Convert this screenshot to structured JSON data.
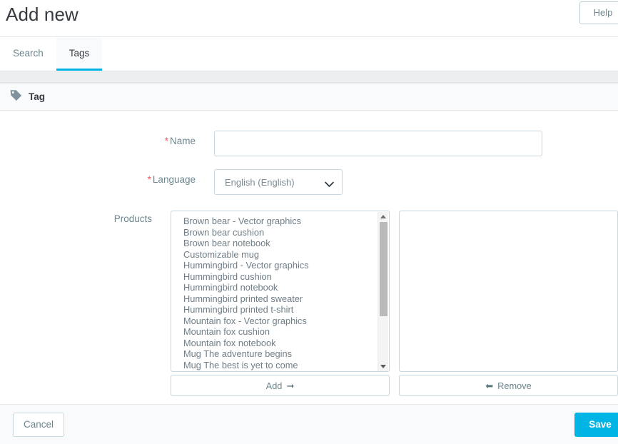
{
  "header": {
    "title": "Add new",
    "help_label": "Help"
  },
  "tabs": [
    {
      "label": "Search",
      "active": false
    },
    {
      "label": "Tags",
      "active": true
    }
  ],
  "panel": {
    "icon": "tag-icon",
    "title": "Tag"
  },
  "form": {
    "name": {
      "label": "Name",
      "required_marker": "*",
      "value": "",
      "placeholder": ""
    },
    "language": {
      "label": "Language",
      "required_marker": "*",
      "selected": "English (English)",
      "options": [
        "English (English)"
      ],
      "caret_icon": "chevron-down-icon"
    },
    "products": {
      "label": "Products",
      "available": [
        "Brown bear - Vector graphics",
        "Brown bear cushion",
        "Brown bear notebook",
        "Customizable mug",
        "Hummingbird - Vector graphics",
        "Hummingbird cushion",
        "Hummingbird notebook",
        "Hummingbird printed sweater",
        "Hummingbird printed t-shirt",
        "Mountain fox - Vector graphics",
        "Mountain fox cushion",
        "Mountain fox notebook",
        "Mug The adventure begins",
        "Mug The best is yet to come"
      ],
      "selected": [],
      "add_label": "Add",
      "add_icon": "arrow-right-icon",
      "remove_label": "Remove",
      "remove_icon": "arrow-left-icon",
      "scrollbar": {
        "up_icon": "scroll-up-arrow-icon",
        "down_icon": "scroll-down-arrow-icon"
      }
    }
  },
  "footer": {
    "cancel_label": "Cancel",
    "save_label": "Save"
  },
  "colors": {
    "accent": "#00b4e6",
    "required": "#f1545a",
    "label_text": "#6c868e",
    "border": "#c7d7de",
    "panel_bg": "#f9fafb",
    "strip_bg": "#edeef0"
  }
}
